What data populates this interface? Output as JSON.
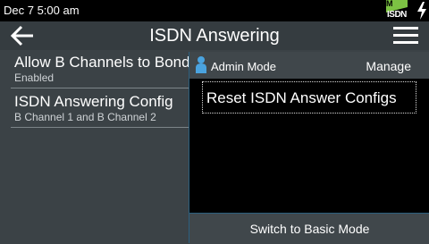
{
  "status_bar": {
    "time": "Dec 7 5:00 am",
    "badge_letter": "M",
    "badge_text": "ISDN",
    "badge_color": "#7cc243"
  },
  "header": {
    "title": "ISDN Answering"
  },
  "list": {
    "items": [
      {
        "title": "Allow B Channels to Bond",
        "subtitle": "Enabled"
      },
      {
        "title": "ISDN Answering Config",
        "subtitle": "B Channel 1 and B Channel 2"
      }
    ]
  },
  "panel": {
    "mode_label": "Admin Mode",
    "manage_label": "Manage",
    "options": [
      {
        "label": "Reset ISDN Answer Configs"
      }
    ],
    "switch_label": "Switch to Basic Mode"
  },
  "icons": {
    "back": "back-arrow-icon",
    "menu": "hamburger-menu-icon",
    "user": "user-icon",
    "charging": "lightning-bolt-icon"
  }
}
